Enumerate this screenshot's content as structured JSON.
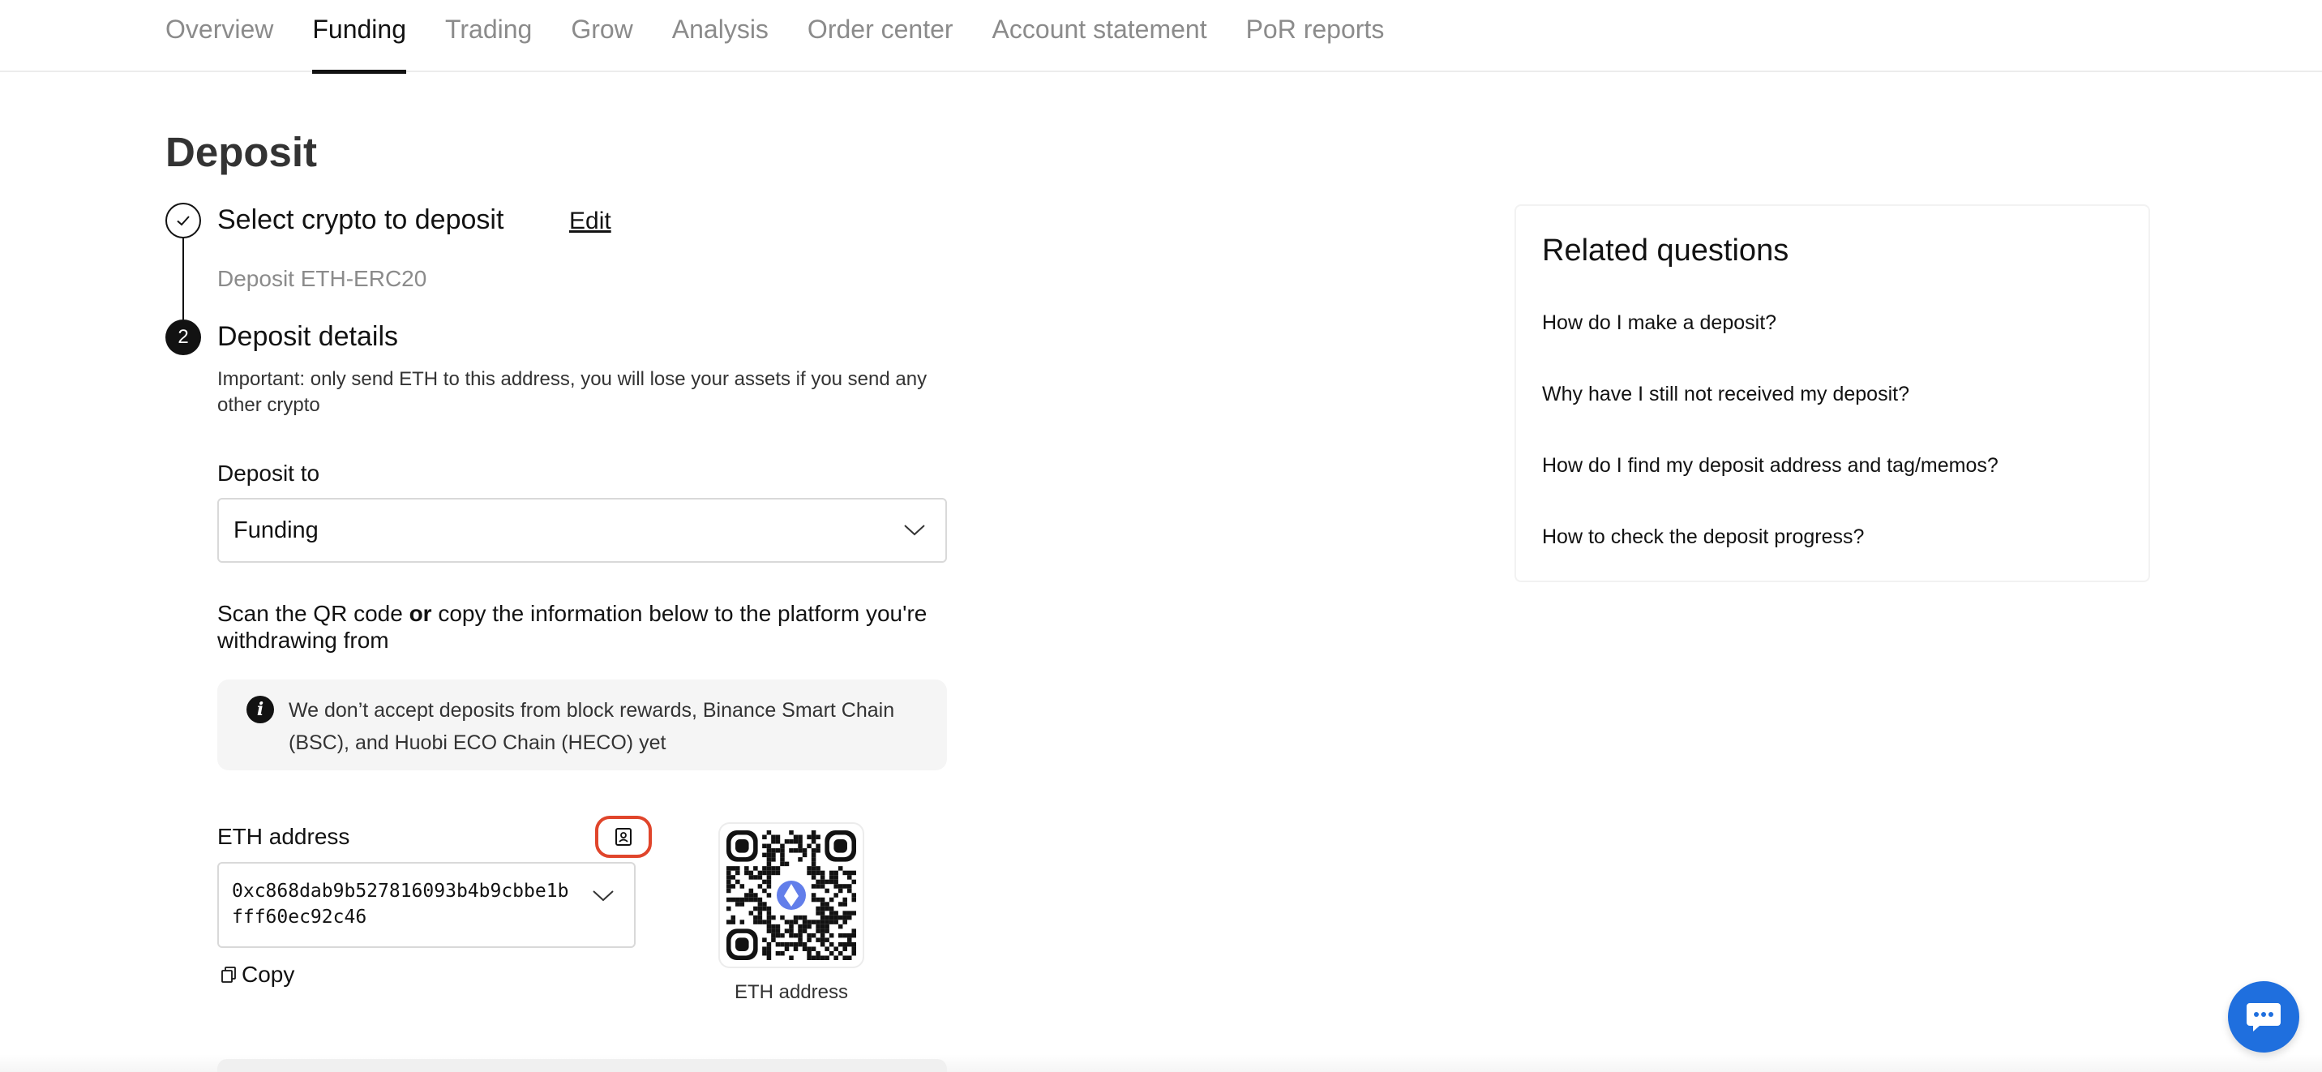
{
  "nav": {
    "tabs": [
      {
        "label": "Overview",
        "active": false
      },
      {
        "label": "Funding",
        "active": true
      },
      {
        "label": "Trading",
        "active": false
      },
      {
        "label": "Grow",
        "active": false
      },
      {
        "label": "Analysis",
        "active": false
      },
      {
        "label": "Order center",
        "active": false
      },
      {
        "label": "Account statement",
        "active": false
      },
      {
        "label": "PoR reports",
        "active": false
      }
    ]
  },
  "page": {
    "title": "Deposit"
  },
  "steps": {
    "step1": {
      "title": "Select crypto to deposit",
      "edit_label": "Edit",
      "selected": "Deposit ETH-ERC20",
      "icon": "checkmark-icon"
    },
    "step2": {
      "number": "2",
      "title": "Deposit details",
      "important": "Important: only send ETH to this address, you will lose your assets if you send any other crypto"
    }
  },
  "deposit_to": {
    "label": "Deposit to",
    "value": "Funding"
  },
  "scan": {
    "prefix": "Scan the QR code ",
    "or": "or",
    "suffix": " copy the information below to the platform you're withdrawing from"
  },
  "notice": {
    "icon": "info-icon",
    "text": "We don’t accept deposits from block rewards, Binance Smart Chain (BSC), and Huobi ECO Chain (HECO) yet"
  },
  "address": {
    "label": "ETH address",
    "value": "0xc868dab9b527816093b4b9cbbe1bfff60ec92c46",
    "copy_label": "Copy",
    "qr_caption": "ETH address",
    "accent_color": "#e0452b"
  },
  "related": {
    "title": "Related questions",
    "questions": [
      "How do I make a deposit?",
      "Why have I still not received my deposit?",
      "How do I find my deposit address and tag/memos?",
      "How to check the deposit progress?"
    ]
  },
  "colors": {
    "chat_button": "#1f6fde",
    "eth_logo": "#627eea"
  }
}
